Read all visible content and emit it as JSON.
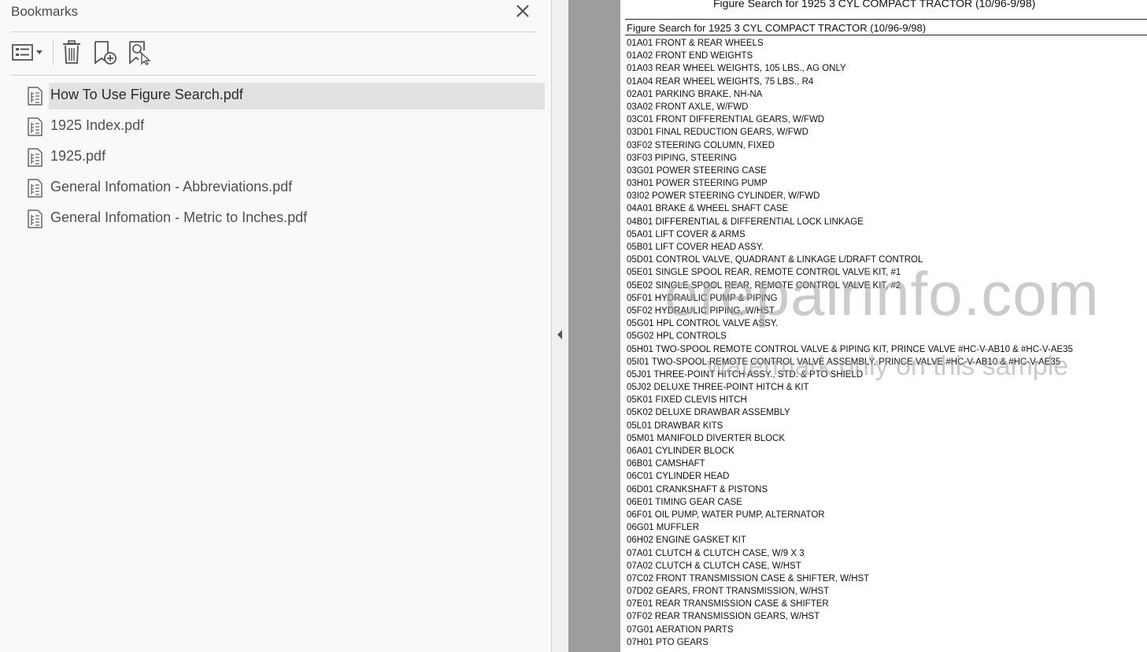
{
  "bookmarks_panel": {
    "title": "Bookmarks",
    "items": [
      {
        "label": "How To Use Figure Search.pdf",
        "selected": true
      },
      {
        "label": "1925 Index.pdf",
        "selected": false
      },
      {
        "label": "1925.pdf",
        "selected": false
      },
      {
        "label": "General Infomation - Abbreviations.pdf",
        "selected": false
      },
      {
        "label": "General Infomation - Metric to Inches.pdf",
        "selected": false
      }
    ]
  },
  "icons": {
    "close": "close-icon",
    "options": "list-options-icon",
    "delete": "trash-icon",
    "add": "add-bookmark-icon",
    "find": "find-current-bookmark-icon",
    "bookmark": "bookmark-document-icon",
    "collapse": "chevron-left-icon"
  },
  "document": {
    "header": "Figure Search for 1925 3 CYL COMPACT TRACTOR (10/96-9/98)",
    "subtitle": "Figure Search for 1925 3 CYL COMPACT TRACTOR (10/96-9/98)",
    "entries": [
      "01A01 FRONT & REAR WHEELS",
      "01A02 FRONT END WEIGHTS",
      "01A03 REAR WHEEL WEIGHTS, 105 LBS., AG ONLY",
      "01A04 REAR WHEEL WEIGHTS, 75 LBS., R4",
      "02A01 PARKING BRAKE, NH-NA",
      "03A02 FRONT AXLE, W/FWD",
      "03C01 FRONT DIFFERENTIAL GEARS, W/FWD",
      "03D01 FINAL REDUCTION GEARS, W/FWD",
      "03F02 STEERING COLUMN, FIXED",
      "03F03 PIPING, STEERING",
      "03G01 POWER STEERING CASE",
      "03H01 POWER STEERING PUMP",
      "03I02 POWER STEERING CYLINDER, W/FWD",
      "04A01 BRAKE & WHEEL SHAFT CASE",
      "04B01 DIFFERENTIAL & DIFFERENTIAL LOCK LINKAGE",
      "05A01 LIFT COVER & ARMS",
      "05B01 LIFT COVER HEAD ASSY.",
      "05D01 CONTROL VALVE, QUADRANT & LINKAGE L/DRAFT CONTROL",
      "05E01 SINGLE SPOOL REAR, REMOTE CONTROL VALVE KIT, #1",
      "05E02 SINGLE SPOOL REAR, REMOTE CONTROL VALVE KIT, #2",
      "05F01 HYDRAULIC PUMP & PIPING",
      "05F02 HYDRAULIC PIPING, W/HST",
      "05G01 HPL CONTROL VALVE ASSY.",
      "05G02 HPL CONTROLS",
      "05H01 TWO-SPOOL REMOTE CONTROL VALVE & PIPING KIT, PRINCE VALVE #HC-V-AB10 & #HC-V-AE35",
      "05I01 TWO-SPOOL REMOTE CONTROL VALVE ASSEMBLY, PRINCE VALVE #HC-V-AB10 & #HC-V-AE35",
      "05J01 THREE-POINT HITCH ASSY., STD. & PTO SHIELD",
      "05J02 DELUXE THREE-POINT HITCH  & KIT",
      "05K01 FIXED CLEVIS HITCH",
      "05K02 DELUXE DRAWBAR ASSEMBLY",
      "05L01 DRAWBAR KITS",
      "05M01 MANIFOLD DIVERTER BLOCK",
      "06A01 CYLINDER BLOCK",
      "06B01 CAMSHAFT",
      "06C01 CYLINDER HEAD",
      "06D01 CRANKSHAFT & PISTONS",
      "06E01 TIMING GEAR CASE",
      "06F01 OIL PUMP, WATER PUMP, ALTERNATOR",
      "06G01 MUFFLER",
      "06H02 ENGINE GASKET KIT",
      "07A01 CLUTCH & CLUTCH CASE, W/9 X 3",
      "07A02 CLUTCH & CLUTCH CASE, W/HST",
      "07C02 FRONT TRANSMISSION CASE & SHIFTER, W/HST",
      "07D02 GEARS, FRONT TRANSMISSION, W/HST",
      "07E01 REAR TRANSMISSION CASE & SHIFTER",
      "07F02 REAR TRANSMISSION GEARS, W/HST",
      "07G01 AERATION PARTS",
      "07H01 PTO GEARS"
    ],
    "watermark": "erepairinfo.com",
    "watermark_sub": "watermark only on this sample"
  }
}
